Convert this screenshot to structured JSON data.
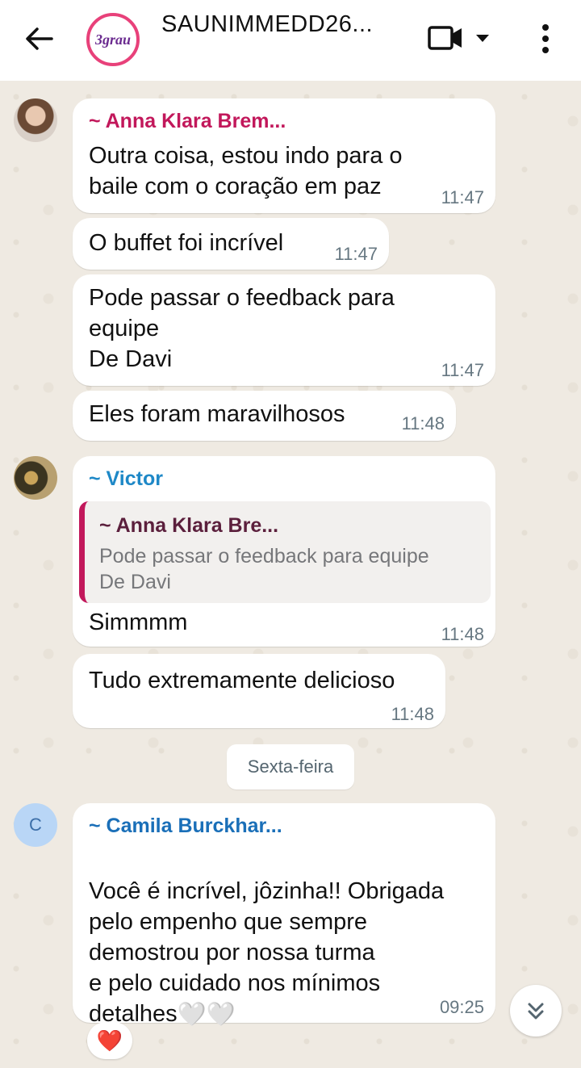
{
  "header": {
    "title": "SAUNIMMEDD26...",
    "group_logo_text": "3grau"
  },
  "colors": {
    "anna": "#c2185b",
    "victor": "#1e88c7",
    "camila": "#1a6fb8"
  },
  "messages": [
    {
      "sender": "~ Anna Klara Brem...",
      "text": "Outra coisa, estou indo para o\nbaile com o coração em paz",
      "time": "11:47"
    },
    {
      "text": "O buffet foi incrível",
      "time": "11:47"
    },
    {
      "text": "Pode passar o feedback para\nequipe\nDe Davi",
      "time": "11:47"
    },
    {
      "text": "Eles foram maravilhosos",
      "time": "11:48"
    },
    {
      "sender": "~ Victor",
      "quote": {
        "sender": "~ Anna Klara Bre...",
        "text": "Pode passar o feedback para equipe\nDe Davi"
      },
      "text": "Simmmm",
      "time": "11:48"
    },
    {
      "text": "Tudo extremamente delicioso",
      "time": "11:48"
    },
    {
      "sender": "~ Camila Burckhar...",
      "avatar_letter": "C",
      "text": "Você é incrível, jôzinha!! Obrigada\npelo empenho que sempre\ndemostrou por nossa turma\ne pelo cuidado nos mínimos\ndetalhes",
      "emoji": "🤍🤍",
      "time": "09:25",
      "reaction": "❤️"
    }
  ],
  "date_separator": "Sexta-feira"
}
